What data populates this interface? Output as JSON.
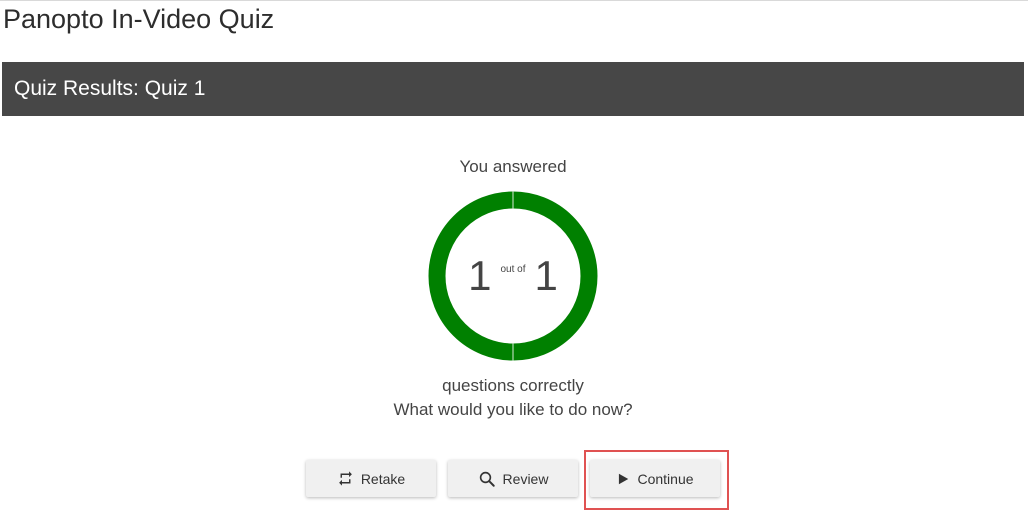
{
  "page": {
    "title": "Panopto In-Video Quiz"
  },
  "header": {
    "quiz_title": "Quiz Results: Quiz 1",
    "background_color": "#474747"
  },
  "results": {
    "answered_label": "You answered",
    "correct_count": "1",
    "out_of_label": "out of",
    "total_count": "1",
    "score_fraction": 1.0,
    "ring_color": "#008000",
    "correct_label": "questions correctly",
    "prompt_label": "What would you like to do now?"
  },
  "actions": {
    "retake": {
      "label": "Retake",
      "icon": "repeat-icon"
    },
    "review": {
      "label": "Review",
      "icon": "search-icon"
    },
    "continue": {
      "label": "Continue",
      "icon": "play-icon",
      "highlighted": true
    }
  },
  "highlight_color": "#e05252"
}
